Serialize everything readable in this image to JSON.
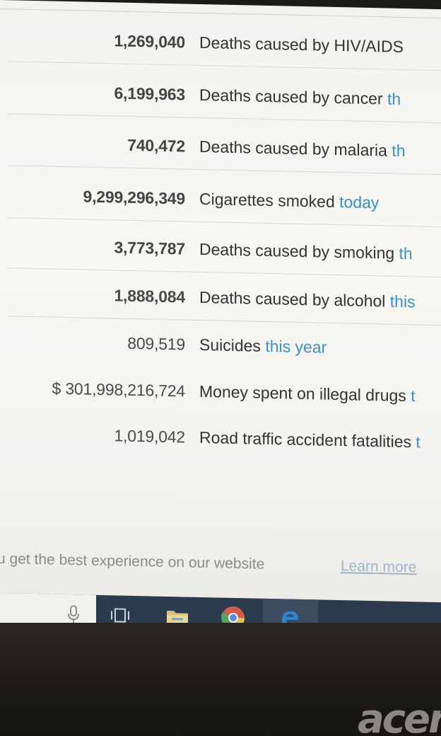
{
  "stats": [
    {
      "number": "1,269,040",
      "text": "Deaths caused by HIV/AIDS",
      "period": ""
    },
    {
      "number": "6,199,963",
      "text": "Deaths caused by cancer ",
      "period": "th"
    },
    {
      "number": "740,472",
      "text": "Deaths caused by malaria ",
      "period": "th"
    },
    {
      "number": "9,299,296,349",
      "text": "Cigarettes smoked ",
      "period": "today"
    },
    {
      "number": "3,773,787",
      "text": "Deaths caused by smoking ",
      "period": "th"
    },
    {
      "number": "1,888,084",
      "text": "Deaths caused by alcohol ",
      "period": "this"
    },
    {
      "number": "809,519",
      "text": "Suicides ",
      "period": "this year"
    },
    {
      "number": "$ 301,998,216,724",
      "text": "Money spent on illegal drugs ",
      "period": "t"
    },
    {
      "number": "1,019,042",
      "text": "Road traffic accident fatalities ",
      "period": "t"
    }
  ],
  "cookie_banner": {
    "text": "u get the best experience on our website",
    "link": "Learn more"
  },
  "taskbar": {
    "icons": [
      "microphone-icon",
      "task-view-icon",
      "file-explorer-icon",
      "chrome-icon",
      "edge-icon"
    ],
    "active": "edge-icon"
  },
  "laptop_brand": "acer",
  "colors": {
    "link": "#3c8ec9",
    "taskbar": "#2b3a4d",
    "text": "#333333"
  }
}
